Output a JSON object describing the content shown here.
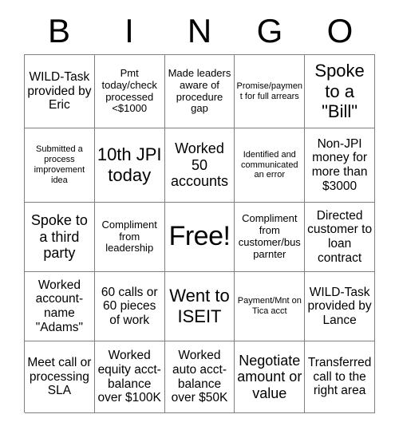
{
  "header": {
    "letters": [
      "B",
      "I",
      "N",
      "G",
      "O"
    ]
  },
  "grid": {
    "rows": [
      [
        {
          "text": "WILD-Task provided by Eric",
          "size": "md"
        },
        {
          "text": "Pmt today/check processed <$1000",
          "size": "sm"
        },
        {
          "text": "Made leaders aware of procedure gap",
          "size": "sm"
        },
        {
          "text": "Promise/payment for full arrears",
          "size": "xs"
        },
        {
          "text": "Spoke to a \"Bill\"",
          "size": "xl"
        }
      ],
      [
        {
          "text": "Submitted a process improvement idea",
          "size": "xs"
        },
        {
          "text": "10th JPI today",
          "size": "xl"
        },
        {
          "text": "Worked 50 accounts",
          "size": "lg"
        },
        {
          "text": "Identified and communicated an error",
          "size": "xs"
        },
        {
          "text": "Non-JPI money for more than $3000",
          "size": "md"
        }
      ],
      [
        {
          "text": "Spoke to a third party",
          "size": "lg"
        },
        {
          "text": "Compliment from leadership",
          "size": "sm"
        },
        {
          "text": "Free!",
          "size": "free"
        },
        {
          "text": "Compliment from customer/bus parnter",
          "size": "sm"
        },
        {
          "text": "Directed customer to loan contract",
          "size": "md"
        }
      ],
      [
        {
          "text": "Worked account-name \"Adams\"",
          "size": "md"
        },
        {
          "text": "60 calls or 60 pieces of work",
          "size": "md"
        },
        {
          "text": "Went to ISEIT",
          "size": "xl"
        },
        {
          "text": "Payment/Mnt on Tica acct",
          "size": "xs"
        },
        {
          "text": "WILD-Task provided by Lance",
          "size": "md"
        }
      ],
      [
        {
          "text": "Meet call or processing SLA",
          "size": "md"
        },
        {
          "text": "Worked equity acct-balance over $100K",
          "size": "md"
        },
        {
          "text": "Worked auto acct-balance over $50K",
          "size": "md"
        },
        {
          "text": "Negotiate amount or value",
          "size": "lg"
        },
        {
          "text": "Transferred call to the right area",
          "size": "md"
        }
      ]
    ]
  }
}
